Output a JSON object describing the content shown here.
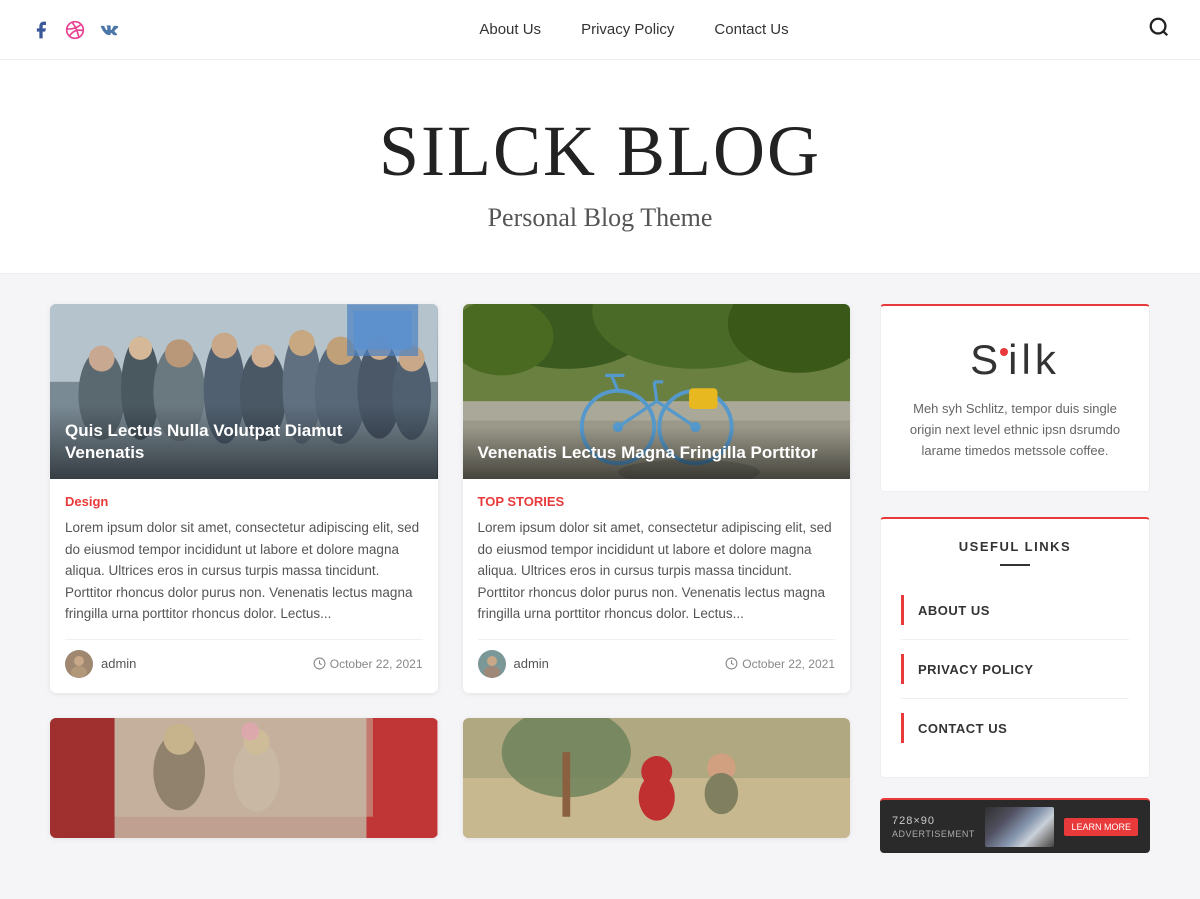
{
  "header": {
    "nav": {
      "about": "About Us",
      "privacy": "Privacy Policy",
      "contact": "Contact Us"
    }
  },
  "hero": {
    "title": "SILCK BLOG",
    "subtitle": "Personal Blog Theme"
  },
  "posts": [
    {
      "id": "post-1",
      "overlay_title": "Quis Lectus Nulla Volutpat Diamut Venenatis",
      "category": "Design",
      "excerpt": "Lorem ipsum dolor sit amet, consectetur adipiscing elit, sed do eiusmod tempor incididunt ut labore et dolore magna aliqua. Ultrices eros in cursus turpis massa tincidunt. Porttitor rhoncus dolor purus non. Venenatis lectus magna fringilla urna porttitor rhoncus dolor. Lectus...",
      "author": "admin",
      "date": "October 22, 2021",
      "image_type": "crowd"
    },
    {
      "id": "post-2",
      "overlay_title": "Venenatis Lectus Magna Fringilla Porttitor",
      "category": "TOP STORIES",
      "excerpt": "Lorem ipsum dolor sit amet, consectetur adipiscing elit, sed do eiusmod tempor incididunt ut labore et dolore magna aliqua. Ultrices eros in cursus turpis massa tincidunt. Porttitor rhoncus dolor purus non. Venenatis lectus magna fringilla urna porttitor rhoncus dolor. Lectus...",
      "author": "admin",
      "date": "October 22, 2021",
      "image_type": "bike"
    },
    {
      "id": "post-3",
      "overlay_title": "",
      "category": "",
      "excerpt": "",
      "author": "",
      "date": "",
      "image_type": "wedding"
    },
    {
      "id": "post-4",
      "overlay_title": "",
      "category": "",
      "excerpt": "",
      "author": "",
      "date": "",
      "image_type": "outdoor"
    }
  ],
  "sidebar": {
    "logo": {
      "text_s": "S",
      "text_ilk": "ilk",
      "full": "Silk"
    },
    "about_text": "Meh syh Schlitz, tempor duis single origin next level ethnic ipsn dsrumdo larame timedos metssole coffee.",
    "useful_links_title": "USEFUL LINKS",
    "links": [
      {
        "label": "ABOUT US"
      },
      {
        "label": "PRIVACY POLICY"
      },
      {
        "label": "CONTACT US"
      }
    ],
    "ad": {
      "size": "728×90",
      "label": "ADVERTISEMENT",
      "button": "LEARN MORE"
    }
  },
  "icons": {
    "facebook": "facebook-icon",
    "dribbble": "dribbble-icon",
    "vk": "vk-icon",
    "search": "search-icon",
    "clock": "clock-icon"
  }
}
